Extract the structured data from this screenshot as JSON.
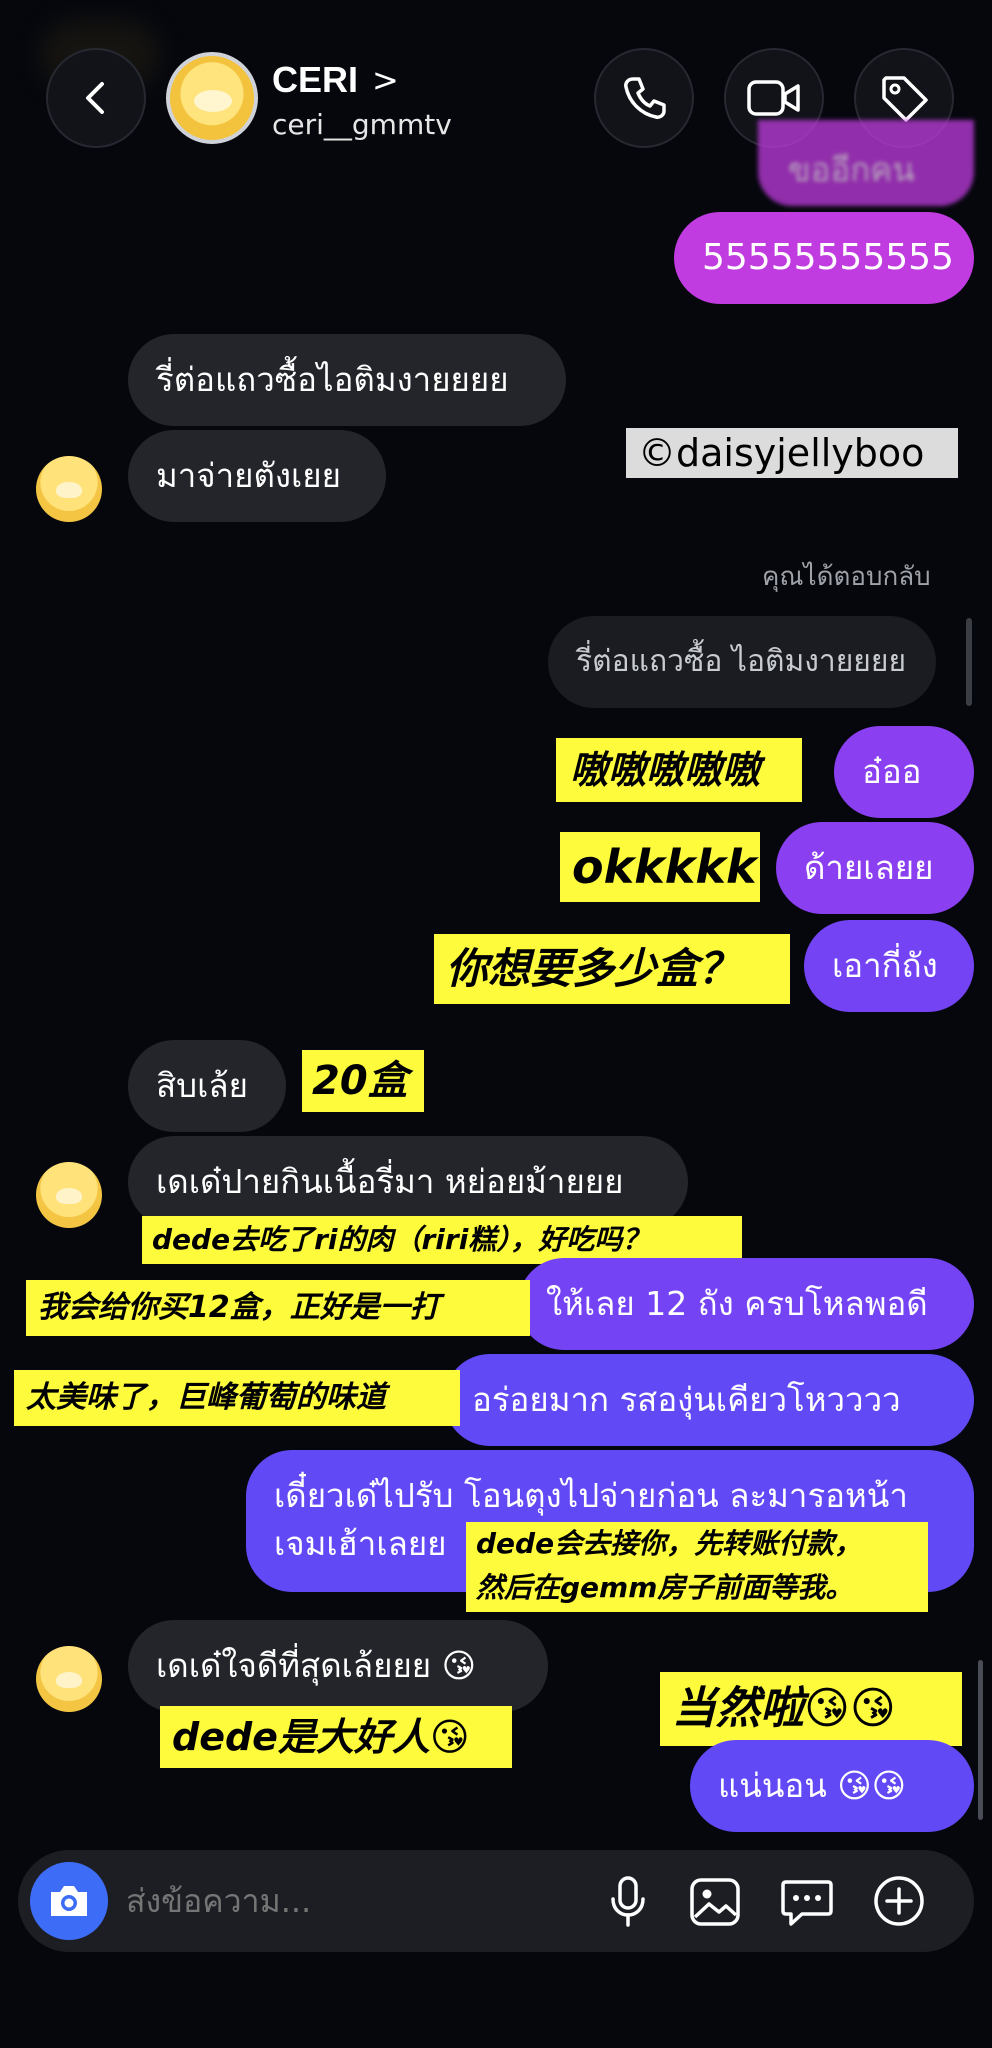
{
  "header": {
    "name": "CERI",
    "chevron": ">",
    "handle": "ceri__gmmtv",
    "icons": [
      "back-icon",
      "phone-icon",
      "video-icon",
      "tag-icon"
    ]
  },
  "watermark": "©daisyjellyboo",
  "messages": {
    "top_partial": "ขออีกคน",
    "m1": "55555555555",
    "r1": "รี่ต่อแถวซื้อไอติมงายยยย",
    "r2": "มาจ่ายตังเยย",
    "reply_label": "คุณได้ตอบกลับ",
    "quoted": "รี่ต่อแถวซื้อ ไอติมงายยยย",
    "s1": "อ๋ออ",
    "s2": "ด้ายเลยย",
    "s3": "เอากี่ถัง",
    "r3": "สิบเล้ย",
    "r4": "เดเด๋ปายกินเนื้อรี่มา หย่อยม้ายยย",
    "s4": "ให้เลย 12 ถัง ครบโหลพอดี",
    "s5": "อร่อยมาก รสองุ่นเคียวโหวววว",
    "s6_line1": "เดี๋ยวเด๋ไปรับ โอนตุงไปจ่ายก่อน ละมารอหน้า",
    "s6_line2": "เจมเฮ้าเลยย",
    "r5": "เดเด๋ใจดีที่สุดเล้ยยย 😘",
    "s7": "แน่นอน 😘😘"
  },
  "notes": {
    "n1": "嗷嗷嗷嗷嗷",
    "n2": "okkkkk",
    "n3": "你想要多少盒？",
    "n4": "20盒",
    "n5": "dede去吃了ri的肉（riri糕），好吃吗？",
    "n6": "我会给你买12盒，正好是一打",
    "n7": "太美味了，巨峰葡萄的味道",
    "n8_line1": "dede会去接你，先转账付款，",
    "n8_line2": "然后在gemm房子前面等我。",
    "n9": "dede是大好人😘",
    "n10": "当然啦😘😘"
  },
  "composer": {
    "placeholder": "ส่งข้อความ...",
    "icons": [
      "camera-icon",
      "mic-icon",
      "image-icon",
      "sticker-icon",
      "plus-icon"
    ]
  }
}
